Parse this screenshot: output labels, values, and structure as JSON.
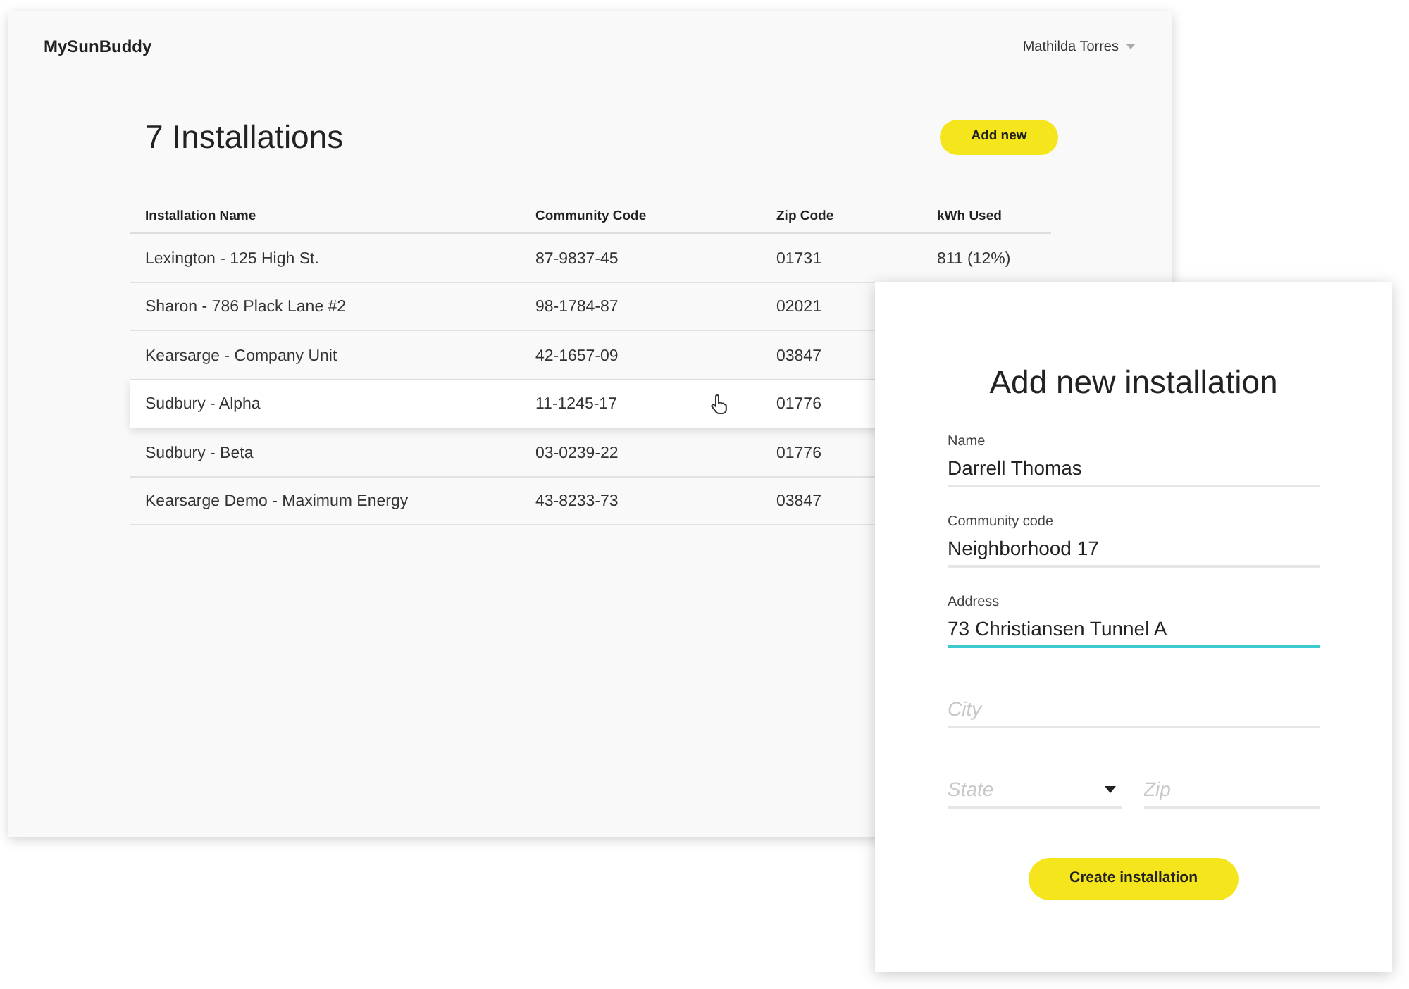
{
  "app": {
    "logo": "MySunBuddy",
    "user": "Mathilda Torres"
  },
  "page": {
    "title": "7 Installations",
    "add_button": "Add new"
  },
  "table": {
    "columns": [
      "Installation Name",
      "Community Code",
      "Zip Code",
      "kWh Used"
    ],
    "rows": [
      {
        "name": "Lexington - 125 High St.",
        "community_code": "87-9837-45",
        "zip": "01731",
        "kwh": "811 (12%)",
        "selected": false
      },
      {
        "name": "Sharon - 786 Plack Lane #2",
        "community_code": "98-1784-87",
        "zip": "02021",
        "selected": false
      },
      {
        "name": "Kearsarge - Company Unit",
        "community_code": "42-1657-09",
        "zip": "03847",
        "selected": false
      },
      {
        "name": "Sudbury - Alpha",
        "community_code": "11-1245-17",
        "zip": "01776",
        "selected": true
      },
      {
        "name": "Sudbury - Beta",
        "community_code": "03-0239-22",
        "zip": "01776",
        "selected": false
      },
      {
        "name": "Kearsarge Demo - Maximum Energy",
        "community_code": "43-8233-73",
        "zip": "03847",
        "selected": false
      }
    ]
  },
  "dialog": {
    "title": "Add new installation",
    "fields": [
      {
        "label": "Name",
        "value": "Darrell Thomas",
        "focused": false
      },
      {
        "label": "Community code",
        "value": "Neighborhood 17",
        "focused": false
      },
      {
        "label": "Address",
        "value": "73 Christiansen Tunnel A",
        "focused": true
      },
      {
        "placeholder": "City",
        "focused": false
      }
    ],
    "state_select": {
      "placeholder": "State"
    },
    "zip_field": {
      "placeholder": "Zip"
    },
    "submit": "Create installation"
  }
}
